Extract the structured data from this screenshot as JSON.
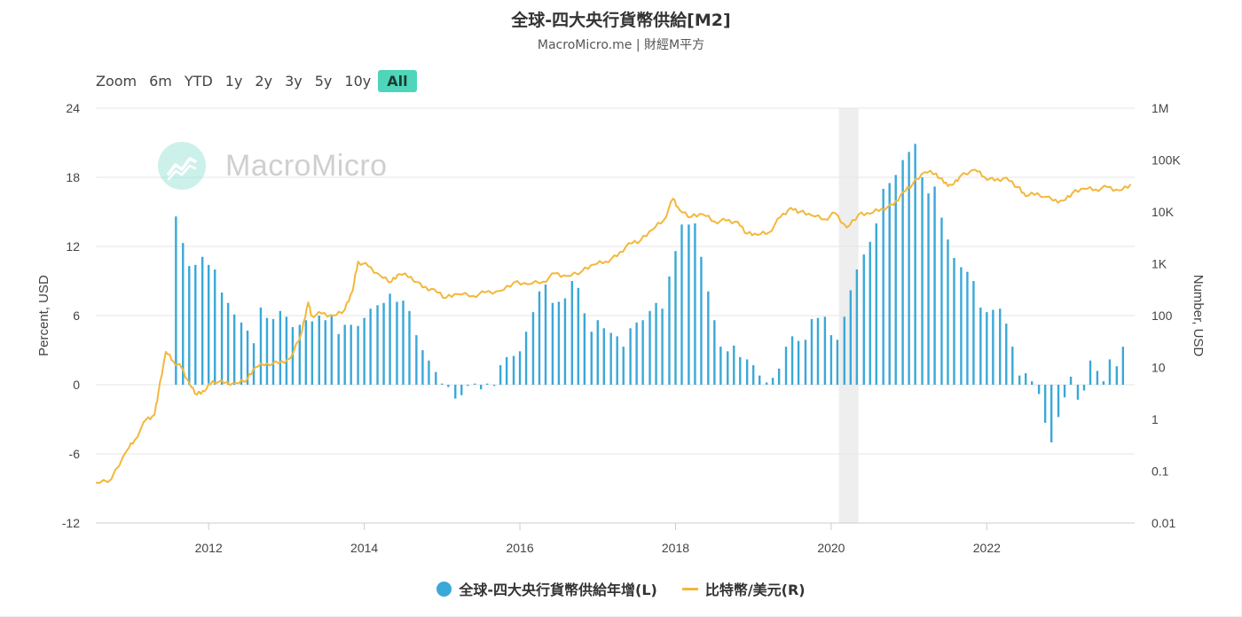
{
  "header": {
    "title": "全球-四大央行貨幣供給[M2]",
    "subtitle": "MacroMicro.me | 財經M平方"
  },
  "zoom": {
    "label": "Zoom",
    "buttons": [
      "6m",
      "YTD",
      "1y",
      "2y",
      "3y",
      "5y",
      "10y",
      "All"
    ],
    "active": "All"
  },
  "watermark": {
    "text": "MacroMicro"
  },
  "legend": {
    "series_l": "全球-四大央行貨幣供給年增(L)",
    "series_r": "比特幣/美元(R)"
  },
  "colors": {
    "bar": "#3aa8d8",
    "line": "#f3b73b",
    "accent": "#4fd5b9",
    "recession": "#eeeeee"
  },
  "chart_data": {
    "type": "bar",
    "title": "全球-四大央行貨幣供給[M2]",
    "subtitle": "MacroMicro.me | 財經M平方",
    "x_range": [
      2010.55,
      2023.9
    ],
    "x_ticks": [
      "2012",
      "2014",
      "2016",
      "2018",
      "2020",
      "2022"
    ],
    "x_tick_values": [
      2012,
      2014,
      2016,
      2018,
      2020,
      2022
    ],
    "y_left": {
      "label": "Percent, USD",
      "min": -12,
      "max": 24,
      "ticks": [
        "-12",
        "-6",
        "0",
        "6",
        "12",
        "18",
        "24"
      ],
      "tick_values": [
        -12,
        -6,
        0,
        6,
        12,
        18,
        24
      ]
    },
    "y_right": {
      "label": "Number, USD",
      "scale": "log",
      "min": 0.01,
      "max": 1000000,
      "ticks": [
        "0.01",
        "0.1",
        "1",
        "10",
        "100",
        "1K",
        "10K",
        "100K",
        "1M"
      ],
      "tick_values": [
        0.01,
        0.1,
        1,
        10,
        100,
        1000,
        10000,
        100000,
        1000000
      ]
    },
    "grid": true,
    "legend_position": "bottom",
    "recession_band": [
      2020.1,
      2020.35
    ],
    "series": [
      {
        "name": "全球-四大央行貨幣供給年增(L)",
        "type": "bar",
        "axis": "left",
        "points": [
          [
            2011.58,
            14.6
          ],
          [
            2011.67,
            12.3
          ],
          [
            2011.75,
            10.3
          ],
          [
            2011.83,
            10.4
          ],
          [
            2011.92,
            11.1
          ],
          [
            2012.0,
            10.4
          ],
          [
            2012.08,
            10.0
          ],
          [
            2012.17,
            8.0
          ],
          [
            2012.25,
            7.1
          ],
          [
            2012.33,
            6.1
          ],
          [
            2012.42,
            5.4
          ],
          [
            2012.5,
            4.7
          ],
          [
            2012.58,
            3.6
          ],
          [
            2012.67,
            6.7
          ],
          [
            2012.75,
            5.8
          ],
          [
            2012.83,
            5.7
          ],
          [
            2012.92,
            6.4
          ],
          [
            2013.0,
            5.9
          ],
          [
            2013.08,
            5.0
          ],
          [
            2013.17,
            5.2
          ],
          [
            2013.25,
            5.6
          ],
          [
            2013.33,
            5.5
          ],
          [
            2013.42,
            6.0
          ],
          [
            2013.5,
            5.6
          ],
          [
            2013.58,
            6.0
          ],
          [
            2013.67,
            4.4
          ],
          [
            2013.75,
            5.2
          ],
          [
            2013.83,
            5.2
          ],
          [
            2013.92,
            5.1
          ],
          [
            2014.0,
            5.8
          ],
          [
            2014.08,
            6.6
          ],
          [
            2014.17,
            6.9
          ],
          [
            2014.25,
            7.1
          ],
          [
            2014.33,
            7.9
          ],
          [
            2014.42,
            7.2
          ],
          [
            2014.5,
            7.3
          ],
          [
            2014.58,
            6.4
          ],
          [
            2014.67,
            4.3
          ],
          [
            2014.75,
            3.0
          ],
          [
            2014.83,
            2.1
          ],
          [
            2014.92,
            1.1
          ],
          [
            2015.0,
            0.1
          ],
          [
            2015.08,
            -0.2
          ],
          [
            2015.17,
            -1.2
          ],
          [
            2015.25,
            -0.9
          ],
          [
            2015.33,
            -0.1
          ],
          [
            2015.42,
            0.1
          ],
          [
            2015.5,
            -0.4
          ],
          [
            2015.58,
            0.1
          ],
          [
            2015.67,
            -0.1
          ],
          [
            2015.75,
            1.7
          ],
          [
            2015.83,
            2.4
          ],
          [
            2015.92,
            2.5
          ],
          [
            2016.0,
            2.9
          ],
          [
            2016.08,
            4.6
          ],
          [
            2016.17,
            6.3
          ],
          [
            2016.25,
            8.1
          ],
          [
            2016.33,
            8.7
          ],
          [
            2016.42,
            7.1
          ],
          [
            2016.5,
            7.2
          ],
          [
            2016.58,
            7.5
          ],
          [
            2016.67,
            9.0
          ],
          [
            2016.75,
            8.4
          ],
          [
            2016.83,
            6.2
          ],
          [
            2016.92,
            4.6
          ],
          [
            2017.0,
            5.6
          ],
          [
            2017.08,
            4.9
          ],
          [
            2017.17,
            4.5
          ],
          [
            2017.25,
            4.2
          ],
          [
            2017.33,
            3.3
          ],
          [
            2017.42,
            4.9
          ],
          [
            2017.5,
            5.4
          ],
          [
            2017.58,
            5.6
          ],
          [
            2017.67,
            6.4
          ],
          [
            2017.75,
            7.1
          ],
          [
            2017.83,
            6.6
          ],
          [
            2017.92,
            9.4
          ],
          [
            2018.0,
            11.6
          ],
          [
            2018.08,
            13.9
          ],
          [
            2018.17,
            13.9
          ],
          [
            2018.25,
            14.0
          ],
          [
            2018.33,
            11.1
          ],
          [
            2018.42,
            8.1
          ],
          [
            2018.5,
            5.6
          ],
          [
            2018.58,
            3.3
          ],
          [
            2018.67,
            2.9
          ],
          [
            2018.75,
            3.4
          ],
          [
            2018.83,
            2.4
          ],
          [
            2018.92,
            2.2
          ],
          [
            2019.0,
            1.7
          ],
          [
            2019.08,
            0.8
          ],
          [
            2019.17,
            0.2
          ],
          [
            2019.25,
            0.6
          ],
          [
            2019.33,
            1.4
          ],
          [
            2019.42,
            3.3
          ],
          [
            2019.5,
            4.2
          ],
          [
            2019.58,
            3.8
          ],
          [
            2019.67,
            3.9
          ],
          [
            2019.75,
            5.7
          ],
          [
            2019.83,
            5.8
          ],
          [
            2019.92,
            5.9
          ],
          [
            2020.0,
            4.3
          ],
          [
            2020.08,
            3.9
          ],
          [
            2020.17,
            5.9
          ],
          [
            2020.25,
            8.2
          ],
          [
            2020.33,
            10.0
          ],
          [
            2020.42,
            11.3
          ],
          [
            2020.5,
            12.4
          ],
          [
            2020.58,
            14.0
          ],
          [
            2020.67,
            17.0
          ],
          [
            2020.75,
            17.5
          ],
          [
            2020.83,
            18.2
          ],
          [
            2020.92,
            19.5
          ],
          [
            2021.0,
            20.2
          ],
          [
            2021.08,
            20.9
          ],
          [
            2021.17,
            18.0
          ],
          [
            2021.25,
            16.6
          ],
          [
            2021.33,
            17.2
          ],
          [
            2021.42,
            14.5
          ],
          [
            2021.5,
            12.6
          ],
          [
            2021.58,
            11.0
          ],
          [
            2021.67,
            10.2
          ],
          [
            2021.75,
            9.8
          ],
          [
            2021.83,
            9.0
          ],
          [
            2021.92,
            6.7
          ],
          [
            2022.0,
            6.3
          ],
          [
            2022.08,
            6.5
          ],
          [
            2022.17,
            6.6
          ],
          [
            2022.25,
            5.3
          ],
          [
            2022.33,
            3.3
          ],
          [
            2022.42,
            0.8
          ],
          [
            2022.5,
            1.0
          ],
          [
            2022.58,
            0.3
          ],
          [
            2022.67,
            -0.8
          ],
          [
            2022.75,
            -3.3
          ],
          [
            2022.83,
            -5.0
          ],
          [
            2022.92,
            -2.8
          ],
          [
            2023.0,
            -1.1
          ],
          [
            2023.08,
            0.7
          ],
          [
            2023.17,
            -1.3
          ],
          [
            2023.25,
            -0.5
          ],
          [
            2023.33,
            2.1
          ],
          [
            2023.42,
            1.2
          ],
          [
            2023.5,
            0.3
          ],
          [
            2023.58,
            2.2
          ],
          [
            2023.67,
            1.6
          ],
          [
            2023.75,
            3.3
          ]
        ]
      },
      {
        "name": "比特幣/美元(R)",
        "type": "line",
        "axis": "right",
        "points": [
          [
            2010.55,
            0.06
          ],
          [
            2010.75,
            0.07
          ],
          [
            2010.95,
            0.25
          ],
          [
            2011.05,
            0.4
          ],
          [
            2011.2,
            1.0
          ],
          [
            2011.3,
            1.2
          ],
          [
            2011.35,
            3.0
          ],
          [
            2011.45,
            20.0
          ],
          [
            2011.55,
            13.0
          ],
          [
            2011.65,
            10.0
          ],
          [
            2011.75,
            5.0
          ],
          [
            2011.85,
            3.0
          ],
          [
            2011.95,
            3.5
          ],
          [
            2012.05,
            5.5
          ],
          [
            2012.2,
            5.0
          ],
          [
            2012.35,
            5.0
          ],
          [
            2012.5,
            6.0
          ],
          [
            2012.6,
            10.0
          ],
          [
            2012.75,
            12.0
          ],
          [
            2012.9,
            12.0
          ],
          [
            2013.05,
            15.0
          ],
          [
            2013.2,
            50.0
          ],
          [
            2013.28,
            180.0
          ],
          [
            2013.32,
            100.0
          ],
          [
            2013.45,
            110.0
          ],
          [
            2013.6,
            100.0
          ],
          [
            2013.75,
            130.0
          ],
          [
            2013.85,
            300.0
          ],
          [
            2013.92,
            1100.0
          ],
          [
            2014.05,
            900.0
          ],
          [
            2014.2,
            600.0
          ],
          [
            2014.35,
            450.0
          ],
          [
            2014.45,
            630.0
          ],
          [
            2014.6,
            560.0
          ],
          [
            2014.75,
            350.0
          ],
          [
            2014.9,
            320.0
          ],
          [
            2015.05,
            220.0
          ],
          [
            2015.2,
            260.0
          ],
          [
            2015.4,
            240.0
          ],
          [
            2015.55,
            280.0
          ],
          [
            2015.75,
            300.0
          ],
          [
            2015.92,
            430.0
          ],
          [
            2016.1,
            400.0
          ],
          [
            2016.3,
            450.0
          ],
          [
            2016.45,
            650.0
          ],
          [
            2016.6,
            580.0
          ],
          [
            2016.8,
            720.0
          ],
          [
            2016.95,
            960.0
          ],
          [
            2017.1,
            1100.0
          ],
          [
            2017.25,
            1400.0
          ],
          [
            2017.4,
            2500.0
          ],
          [
            2017.55,
            2800.0
          ],
          [
            2017.7,
            4500.0
          ],
          [
            2017.85,
            7000.0
          ],
          [
            2017.97,
            18000.0
          ],
          [
            2018.05,
            11000.0
          ],
          [
            2018.2,
            8000.0
          ],
          [
            2018.35,
            9000.0
          ],
          [
            2018.5,
            6500.0
          ],
          [
            2018.65,
            6800.0
          ],
          [
            2018.8,
            6400.0
          ],
          [
            2018.92,
            3800.0
          ],
          [
            2019.05,
            3600.0
          ],
          [
            2019.2,
            4000.0
          ],
          [
            2019.35,
            8000.0
          ],
          [
            2019.48,
            12000.0
          ],
          [
            2019.6,
            10000.0
          ],
          [
            2019.75,
            8500.0
          ],
          [
            2019.92,
            7200.0
          ],
          [
            2020.05,
            9500.0
          ],
          [
            2020.2,
            5000.0
          ],
          [
            2020.35,
            8800.0
          ],
          [
            2020.5,
            9200.0
          ],
          [
            2020.65,
            11500.0
          ],
          [
            2020.8,
            13500.0
          ],
          [
            2020.92,
            24000.0
          ],
          [
            2021.05,
            35000.0
          ],
          [
            2021.2,
            58000.0
          ],
          [
            2021.35,
            55000.0
          ],
          [
            2021.45,
            36000.0
          ],
          [
            2021.55,
            33000.0
          ],
          [
            2021.65,
            47000.0
          ],
          [
            2021.85,
            65000.0
          ],
          [
            2021.97,
            47000.0
          ],
          [
            2022.1,
            40000.0
          ],
          [
            2022.25,
            46000.0
          ],
          [
            2022.4,
            30000.0
          ],
          [
            2022.5,
            20000.0
          ],
          [
            2022.65,
            23000.0
          ],
          [
            2022.85,
            16500.0
          ],
          [
            2022.98,
            16500.0
          ],
          [
            2023.1,
            23000.0
          ],
          [
            2023.25,
            28000.0
          ],
          [
            2023.4,
            27000.0
          ],
          [
            2023.55,
            30000.0
          ],
          [
            2023.7,
            26000.0
          ],
          [
            2023.85,
            34000.0
          ]
        ]
      }
    ]
  }
}
